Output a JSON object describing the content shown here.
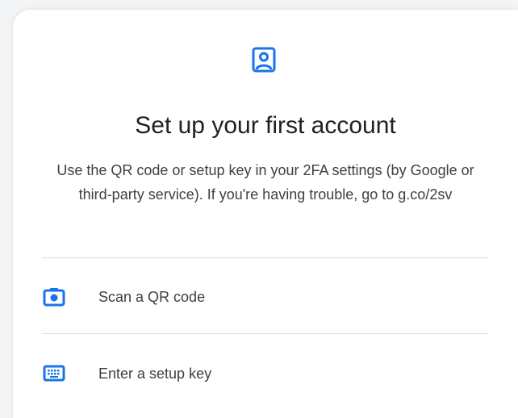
{
  "colors": {
    "accent": "#1a73e8",
    "text_primary": "#202124",
    "text_secondary": "#3c4043",
    "divider": "#dadce0"
  },
  "header": {
    "icon": "account-box-icon",
    "title": "Set up your first account",
    "description": "Use the QR code or setup key in your 2FA settings (by Google or third-party service). If you're having trouble, go to g.co/2sv"
  },
  "options": [
    {
      "icon": "camera-icon",
      "label": "Scan a QR code"
    },
    {
      "icon": "keyboard-icon",
      "label": "Enter a setup key"
    }
  ]
}
